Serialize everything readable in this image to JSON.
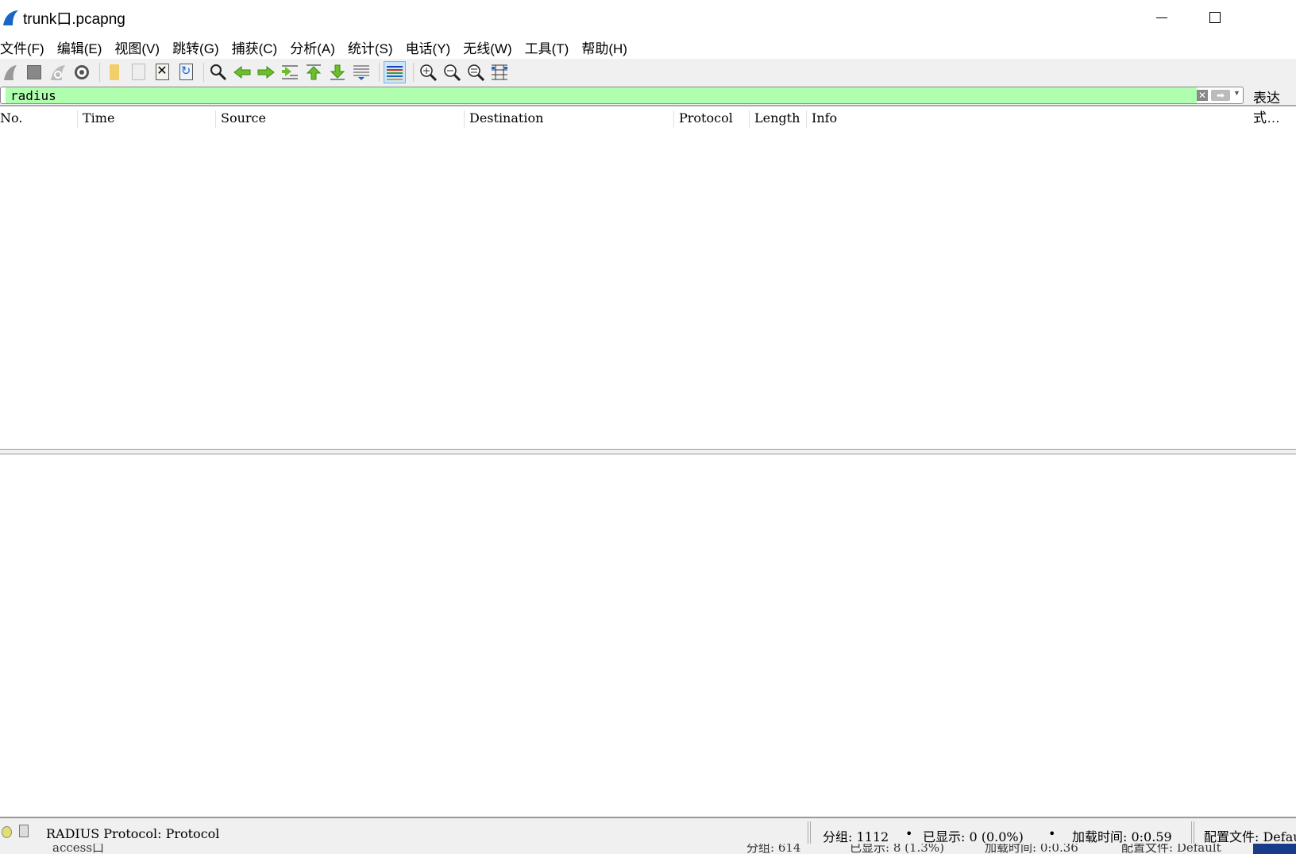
{
  "window": {
    "title": "trunk口.pcapng"
  },
  "menu": [
    "文件(F)",
    "编辑(E)",
    "视图(V)",
    "跳转(G)",
    "捕获(C)",
    "分析(A)",
    "统计(S)",
    "电话(Y)",
    "无线(W)",
    "工具(T)",
    "帮助(H)"
  ],
  "toolbar": {
    "icons": [
      "start-capture-icon",
      "stop-capture-icon",
      "restart-capture-icon",
      "capture-options-icon",
      "open-file-icon",
      "save-file-icon",
      "close-file-icon",
      "reload-file-icon",
      "find-packet-icon",
      "go-back-icon",
      "go-forward-icon",
      "go-to-packet-icon",
      "first-packet-icon",
      "last-packet-icon",
      "auto-scroll-icon",
      "colorize-icon",
      "zoom-in-icon",
      "zoom-out-icon",
      "normal-size-icon",
      "resize-columns-icon"
    ]
  },
  "filter": {
    "value": "radius",
    "expression_label": "表达式…",
    "bg_color": "#afffaf"
  },
  "columns": [
    "No.",
    "Time",
    "Source",
    "Destination",
    "Protocol",
    "Length",
    "Info"
  ],
  "status": {
    "field_info": "RADIUS Protocol: Protocol",
    "packets": "分组: 1112",
    "displayed": "已显示: 0 (0.0%)",
    "load_time": "加载时间: 0:0.59",
    "profile": "配置文件: Default"
  },
  "background_window": {
    "title": "access口",
    "packets": "分组: 614",
    "displayed": "已显示: 8 (1.3%)",
    "load_time": "加载时间: 0:0.36",
    "profile": "配置文件: Default"
  }
}
